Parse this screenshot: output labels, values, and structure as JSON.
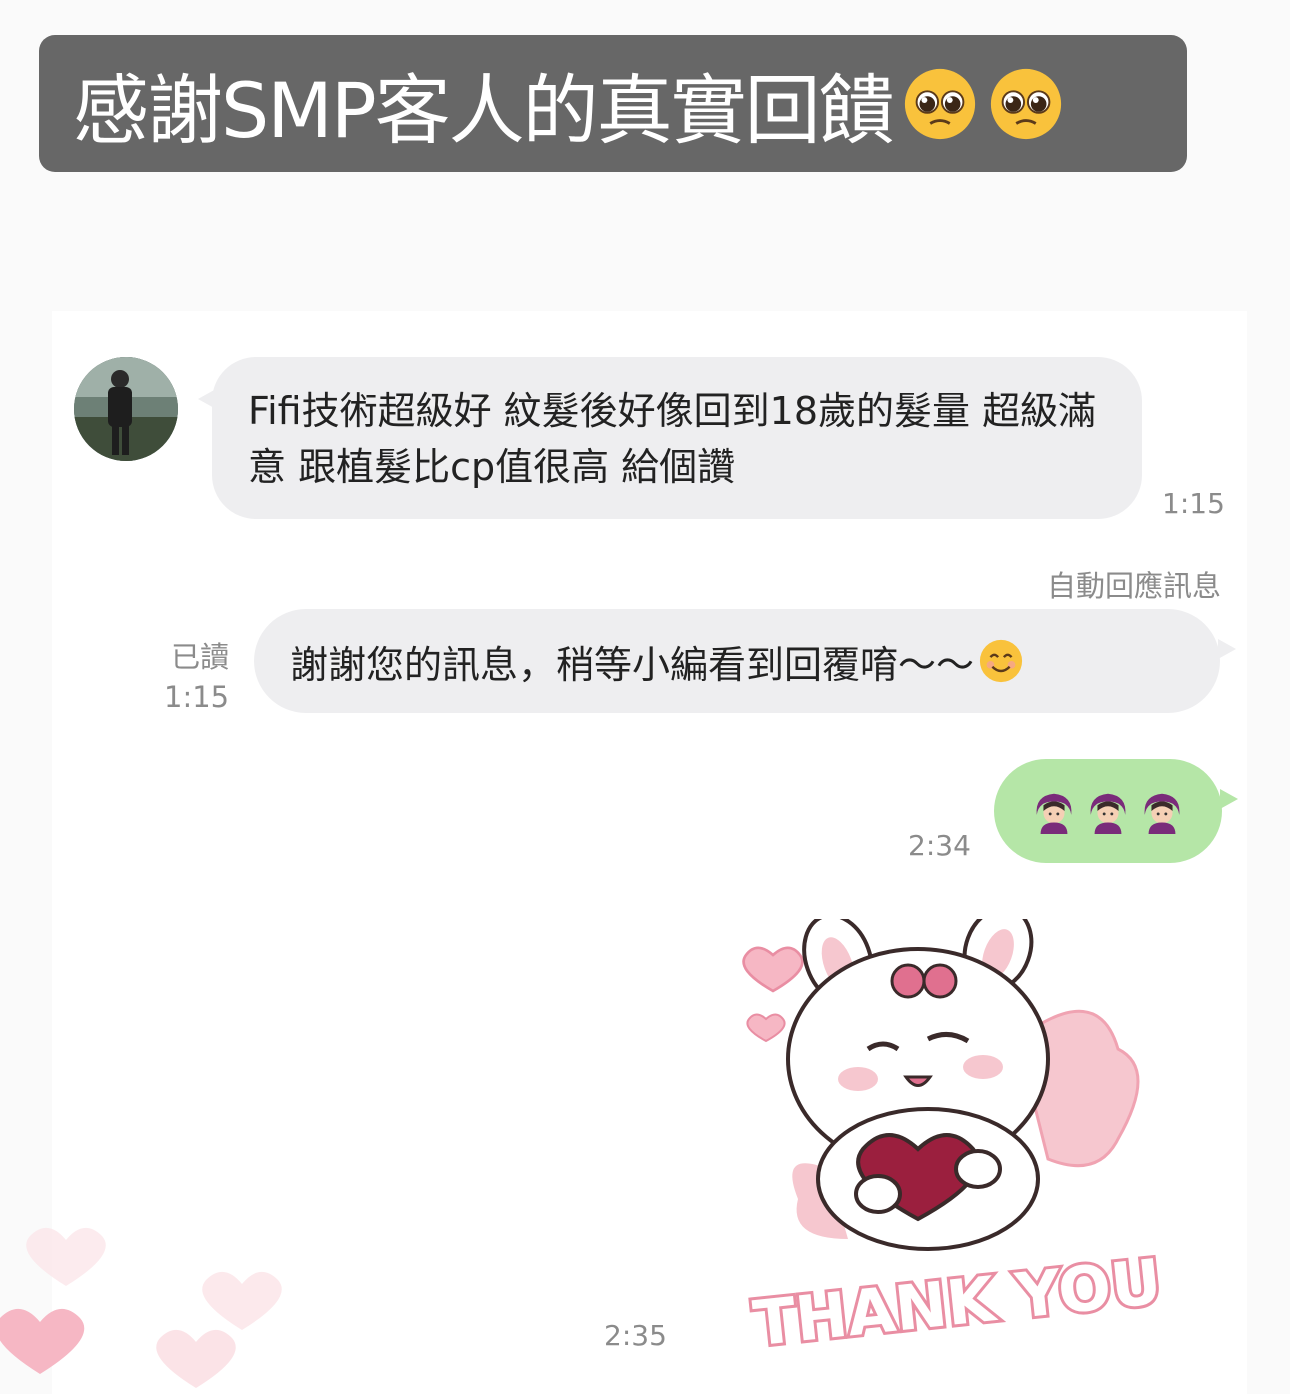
{
  "banner": {
    "title": "感謝SMP客人的真實回饋",
    "emojis": [
      "pleading-face-icon",
      "pleading-face-icon"
    ]
  },
  "chat": {
    "incoming": {
      "text": "Fifi技術超級好 紋髮後好像回到18歲的髮量 超級滿意 跟植髮比cp值很高 給個讚",
      "time": "1:15"
    },
    "auto_reply": {
      "label": "自動回應訊息",
      "read": "已讀",
      "read_time": "1:15",
      "text": "謝謝您的訊息，稍等小編看到回覆唷～～",
      "emoji": "smiling-face-icon"
    },
    "outgoing_emoji": {
      "time": "2:34",
      "emojis": [
        "woman-heart-hands-icon",
        "woman-heart-hands-icon",
        "woman-heart-hands-icon"
      ]
    },
    "sticker": {
      "text": "THANK YOU",
      "time": "2:35"
    }
  },
  "colors": {
    "banner_bg": "#676767",
    "bubble_grey": "#eeeef0",
    "bubble_green": "#b5e6a7",
    "sticker_pink": "#e0708f"
  }
}
